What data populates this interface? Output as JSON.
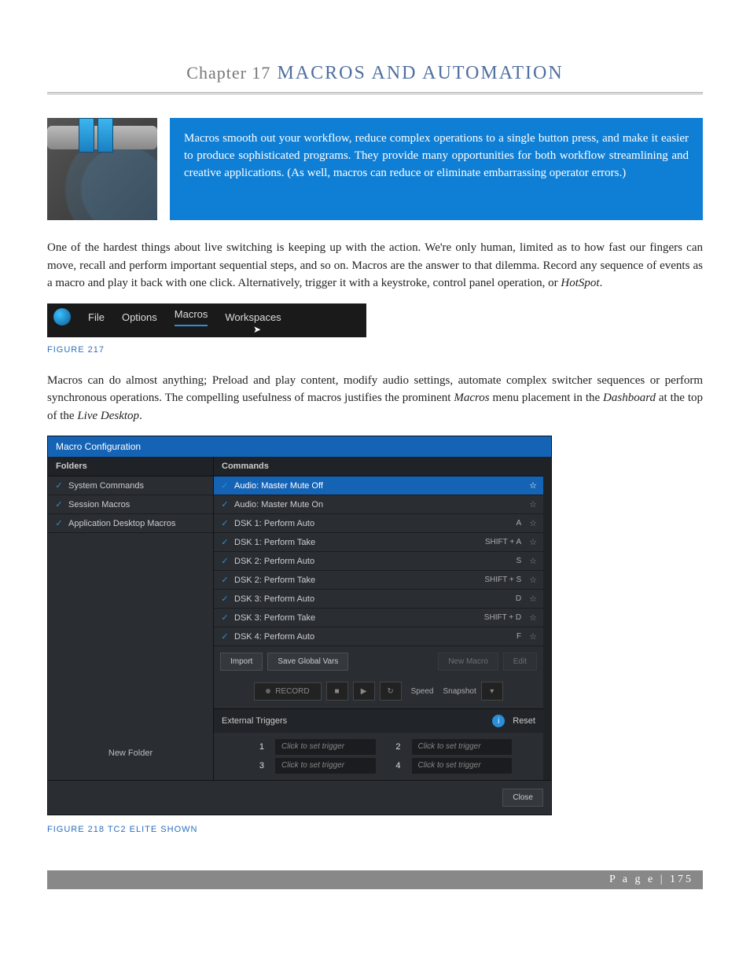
{
  "chapter": {
    "prefix": "Chapter 17",
    "title": "MACROS AND AUTOMATION"
  },
  "intro_box": "Macros smooth out your workflow, reduce complex operations to a single button press, and make it easier to produce sophisticated programs. They provide many opportunities for both workflow streamlining and creative applications. (As well, macros can reduce or eliminate embarrassing operator errors.)",
  "para1": "One of the hardest things about live switching is keeping up with the action. We're only human, limited as to how fast our fingers can move, recall and perform important sequential steps, and so on.  Macros are the answer to that dilemma. Record any sequence of events as a macro and play it back with one click. Alternatively, trigger it with a keystroke, control panel operation, or ",
  "para1_em": "HotSpot",
  "para1_end": ".",
  "menubar": {
    "items": [
      "File",
      "Options",
      "Macros",
      "Workspaces"
    ],
    "selected": "Macros"
  },
  "fig1": "FIGURE 217",
  "para2_a": "Macros can do almost anything; Preload and play content, modify audio settings, automate complex switcher sequences or perform synchronous operations. The compelling usefulness of macros justifies the prominent ",
  "para2_em1": "Macros",
  "para2_b": " menu placement in the ",
  "para2_em2": "Dashboard",
  "para2_c": " at the top of the ",
  "para2_em3": "Live Desktop",
  "para2_d": ".",
  "macro": {
    "title": "Macro Configuration",
    "folders_header": "Folders",
    "commands_header": "Commands",
    "folders": [
      {
        "label": "System Commands"
      },
      {
        "label": "Session Macros"
      },
      {
        "label": "Application Desktop Macros"
      }
    ],
    "commands": [
      {
        "label": "Audio: Master Mute Off",
        "shortcut": "",
        "sel": true
      },
      {
        "label": "Audio: Master Mute On",
        "shortcut": ""
      },
      {
        "label": "DSK 1: Perform Auto",
        "shortcut": "A"
      },
      {
        "label": "DSK 1: Perform Take",
        "shortcut": "SHIFT + A"
      },
      {
        "label": "DSK 2: Perform Auto",
        "shortcut": "S"
      },
      {
        "label": "DSK 2: Perform Take",
        "shortcut": "SHIFT + S"
      },
      {
        "label": "DSK 3: Perform Auto",
        "shortcut": "D"
      },
      {
        "label": "DSK 3: Perform Take",
        "shortcut": "SHIFT + D"
      },
      {
        "label": "DSK 4: Perform Auto",
        "shortcut": "F"
      }
    ],
    "buttons": {
      "import": "Import",
      "save_vars": "Save Global Vars",
      "new_macro": "New Macro",
      "edit": "Edit",
      "record": "RECORD",
      "speed": "Speed",
      "snapshot": "Snapshot"
    },
    "ext_triggers": "External Triggers",
    "reset": "Reset",
    "triggers": [
      {
        "n": "1",
        "v": "Click to set trigger"
      },
      {
        "n": "2",
        "v": "Click to set trigger"
      },
      {
        "n": "3",
        "v": "Click to set trigger"
      },
      {
        "n": "4",
        "v": "Click to set trigger"
      }
    ],
    "new_folder": "New Folder",
    "close": "Close"
  },
  "fig2": "FIGURE 218 TC2 ELITE SHOWN",
  "footer": {
    "label": "P a g e",
    "num": "| 175"
  }
}
